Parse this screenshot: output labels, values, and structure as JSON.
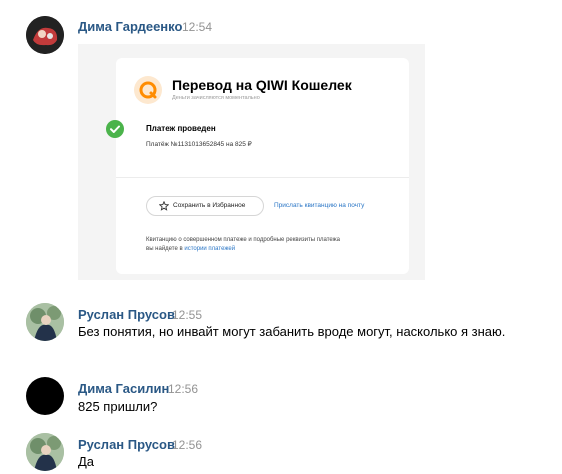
{
  "messages": [
    {
      "author": "Дима Гардеенко",
      "time": "12:54"
    },
    {
      "author": "Руслан Прусов",
      "time": "12:55",
      "text": "Без понятия, но инвайт могут забанить вроде могут, насколько я знаю."
    },
    {
      "author": "Дима Гасилин",
      "time": "12:56",
      "text": "825 пришли?"
    },
    {
      "author": "Руслан Прусов",
      "time": "12:56",
      "text": "Да"
    }
  ],
  "attachment": {
    "title": "Перевод на QIWI Кошелек",
    "subtitle": "Деньги зачисляются моментально",
    "status_title": "Платеж проведен",
    "status_detail": "Платёж №1131013652845 на 825 ₽",
    "favorite_button": "Сохранить в Избранное",
    "receipt_link": "Прислать квитанцию на почту",
    "footnote_line1": "Квитанцию о совершенном платеже и подробные реквизиты платежа",
    "footnote_line2_prefix": "вы найдете в ",
    "footnote_link": "истории платежей"
  },
  "colors": {
    "author": "#2a5885",
    "time": "#939393",
    "link": "#2a76c6",
    "qiwi_orange": "#ff8c00",
    "success_green": "#4bb34b"
  },
  "icons": [
    "avatar",
    "qiwi-logo-icon",
    "check-icon",
    "star-icon"
  ]
}
